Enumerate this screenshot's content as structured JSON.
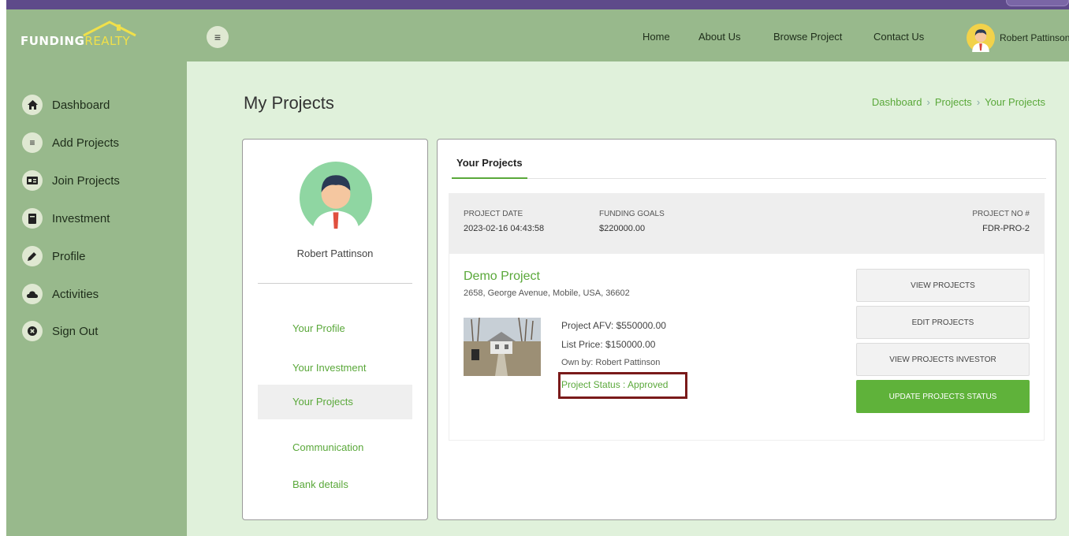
{
  "brand": {
    "logo_text_1": "FUNDING",
    "logo_text_2": "REALTY"
  },
  "topnav": {
    "menu_icon": "menu-icon",
    "links": [
      "Home",
      "About Us",
      "Browse Project",
      "Contact Us"
    ],
    "user_name": "Robert Pattinson"
  },
  "sidebar": {
    "items": [
      {
        "label": "Dashboard",
        "icon": "home-icon"
      },
      {
        "label": "Add Projects",
        "icon": "list-icon"
      },
      {
        "label": "Join Projects",
        "icon": "id-card-icon"
      },
      {
        "label": "Investment",
        "icon": "book-icon"
      },
      {
        "label": "Profile",
        "icon": "pencil-icon"
      },
      {
        "label": "Activities",
        "icon": "cloud-icon"
      },
      {
        "label": "Sign Out",
        "icon": "close-circle-icon"
      }
    ]
  },
  "page": {
    "title": "My Projects",
    "breadcrumb": [
      "Dashboard",
      "Projects",
      "Your Projects"
    ]
  },
  "profile_card": {
    "name": "Robert Pattinson",
    "menu": [
      "Your Profile",
      "Your Investment",
      "Your Projects",
      "Communication",
      "Bank details"
    ],
    "active_item": "Your Projects"
  },
  "projects": {
    "tab_label": "Your Projects",
    "item": {
      "date_label": "PROJECT DATE",
      "date": "2023-02-16 04:43:58",
      "goal_label": "FUNDING GOALS",
      "goal": "$220000.00",
      "no_label": "PROJECT NO #",
      "no": "FDR-PRO-2",
      "title": "Demo Project",
      "address": "2658, George Avenue, Mobile, USA, 36602",
      "afv": "Project AFV: $550000.00",
      "list_price": "List Price: $150000.00",
      "owner": "Own by: Robert Pattinson",
      "status": "Project Status : Approved",
      "buttons": [
        "VIEW PROJECTS",
        "EDIT PROJECTS",
        "VIEW PROJECTS INVESTOR",
        "UPDATE PROJECTS STATUS"
      ]
    }
  },
  "colors": {
    "sidebar_bg": "#98b98c",
    "content_bg": "#e0f1db",
    "accent_green": "#5aa83a",
    "status_highlight": "#7a1a1a"
  }
}
